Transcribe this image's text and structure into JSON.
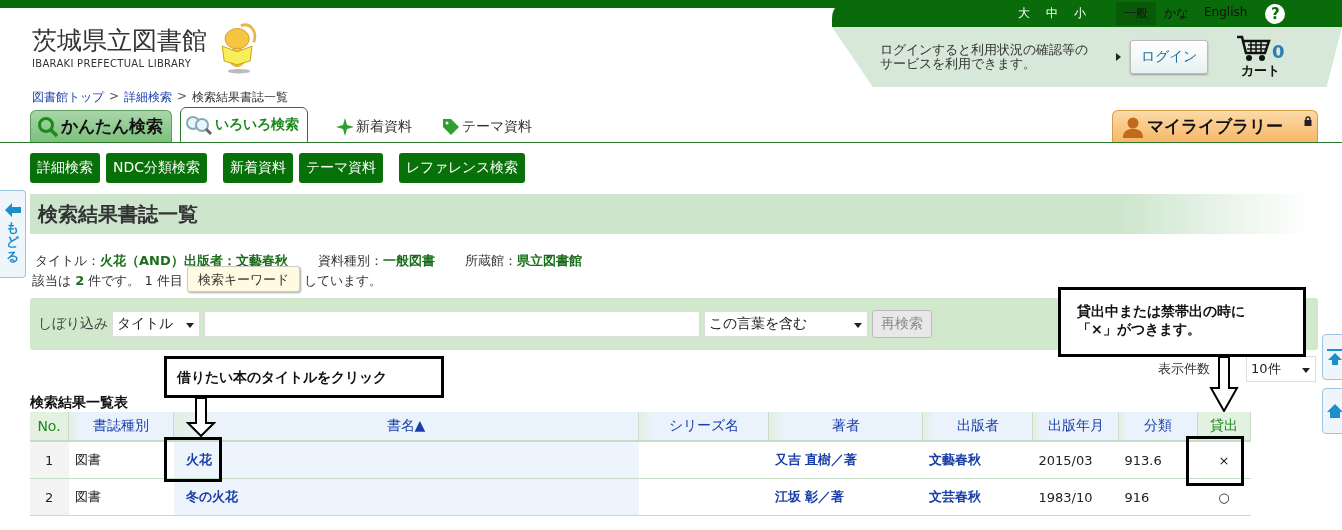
{
  "top_bar": {
    "font_sizes": [
      "大",
      "中",
      "小"
    ],
    "languages": [
      {
        "label": "一般",
        "selected": true
      },
      {
        "label": "かな",
        "selected": false
      },
      {
        "label": "English",
        "selected": false
      }
    ],
    "help": "?"
  },
  "header": {
    "title": "茨城県立図書館",
    "subtitle": "IBARAKI PREFECTUAL LIBRARY",
    "login_message": "ログインすると利用状況の確認等のサービスを利用できます。",
    "login_button": "ログイン",
    "cart_count": "0",
    "cart_label": "カート"
  },
  "breadcrumb": [
    {
      "label": "図書館トップ",
      "link": true,
      "separator": ">"
    },
    {
      "label": "詳細検索",
      "link": true,
      "separator": ">"
    },
    {
      "label": "検索結果書誌一覧",
      "link": false
    }
  ],
  "tabs": [
    {
      "label": "かんたん検索",
      "kind": "main",
      "selected": false
    },
    {
      "label": "いろいろ検索",
      "kind": "main",
      "selected": true
    },
    {
      "label": "新着資料",
      "kind": "new",
      "selected": false
    },
    {
      "label": "テーマ資料",
      "kind": "theme",
      "selected": false
    }
  ],
  "my_library": "マイライブラリー",
  "button_groups": [
    [
      "詳細検索",
      "NDC分類検索"
    ],
    [
      "新着資料",
      "テーマ資料"
    ],
    [
      "レファレンス検索"
    ]
  ],
  "back_tab": "もどる",
  "page_title": "検索結果書誌一覧",
  "criteria": [
    {
      "label": "タイトル：",
      "value": "火花（AND）出版者：文藝春秋"
    },
    {
      "label": "資料種別：",
      "value": "一般図書"
    },
    {
      "label": "所蔵館：",
      "value": "県立図書館"
    }
  ],
  "summary_before": "該当は **2** 件です。 1 件目",
  "tooltip": "検索キーワード",
  "summary_after": "しています。",
  "filter": {
    "label": "しぼり込み",
    "field_select": "タイトル",
    "match_select": "この言葉を含む",
    "button": "再検索",
    "button_disabled": true
  },
  "per_page": {
    "label": "表示件数",
    "value": "10件"
  },
  "table": {
    "caption": "検索結果一覧表",
    "columns": [
      {
        "label": "No.",
        "kind": "plain"
      },
      {
        "label": "書誌種別",
        "kind": "sort"
      },
      {
        "label": "書名▲",
        "kind": "sort"
      },
      {
        "label": "シリーズ名",
        "kind": "sort"
      },
      {
        "label": "著者",
        "kind": "sort"
      },
      {
        "label": "出版者",
        "kind": "sort"
      },
      {
        "label": "出版年月",
        "kind": "sort"
      },
      {
        "label": "分類",
        "kind": "sort"
      },
      {
        "label": "貸出",
        "kind": "plain"
      }
    ],
    "rows": [
      {
        "no": "1",
        "type": "図書",
        "title": "火花",
        "author": "又吉 直樹／著",
        "publisher": "文藝春秋",
        "date": "2015/03",
        "class": "913.6",
        "loan": "×"
      },
      {
        "no": "2",
        "type": "図書",
        "title": "冬の火花",
        "author": "江坂 彰／著",
        "publisher": "文芸春秋",
        "date": "1983/10",
        "class": "916",
        "loan": "○"
      }
    ]
  },
  "callouts": [
    {
      "lines": [
        "借りたい本のタイトルをクリック"
      ]
    },
    {
      "lines": [
        "貸出中または禁帯出の時に",
        "「×」がつきます。"
      ]
    }
  ]
}
